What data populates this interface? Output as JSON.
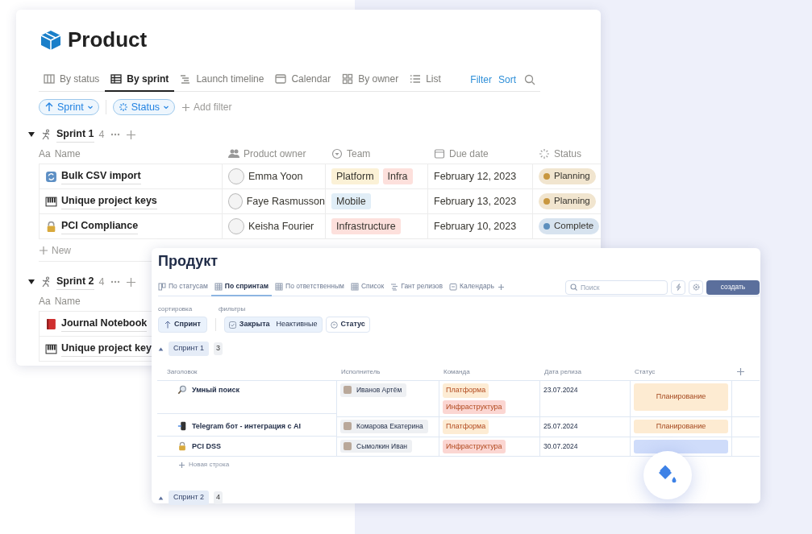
{
  "product_board": {
    "title": "Product",
    "tabs": [
      {
        "label": "By status",
        "selected": false
      },
      {
        "label": "By sprint",
        "selected": true
      },
      {
        "label": "Launch timeline",
        "selected": false
      },
      {
        "label": "Calendar",
        "selected": false
      },
      {
        "label": "By owner",
        "selected": false
      },
      {
        "label": "List",
        "selected": false
      }
    ],
    "actions": [
      "Filter",
      "Sort"
    ],
    "filters": [
      {
        "label": "Sprint"
      },
      {
        "label": "Status"
      }
    ],
    "add_filter": "Add filter",
    "groups": [
      {
        "name": "Sprint 1",
        "count": "4",
        "expanded": true,
        "title_column_marker": "Aa",
        "columns": [
          "Name",
          "Product owner",
          "Team",
          "Due date",
          "Status"
        ],
        "rows": [
          {
            "kind": "sync",
            "name": "Bulk CSV import",
            "owner": "Emma Yoon",
            "team": [
              {
                "label": "Platform",
                "color": "#fbf1d6"
              },
              {
                "label": "Infra",
                "color": "#fde0dc"
              }
            ],
            "due": "February 12, 2023",
            "status": {
              "label": "Planning",
              "color": "#c8973f"
            }
          },
          {
            "kind": "piano",
            "name": "Unique project keys",
            "owner": "Faye Rasmusson",
            "team": [
              {
                "label": "Mobile",
                "color": "#e1eef7"
              }
            ],
            "due": "February 13, 2023",
            "status": {
              "label": "Planning",
              "color": "#c8973f"
            }
          },
          {
            "kind": "lock",
            "name": "PCI Compliance",
            "owner": "Keisha Fourier",
            "team": [
              {
                "label": "Infrastructure",
                "color": "#fde0dc"
              }
            ],
            "due": "February 10, 2023",
            "status": {
              "label": "Complete",
              "color": "#5d8fbd"
            }
          }
        ],
        "new_row": "New"
      },
      {
        "name": "Sprint 2",
        "count": "4",
        "expanded": true,
        "title_column_marker": "Aa",
        "columns": [
          "Name"
        ],
        "rows": [
          {
            "kind": "book",
            "name": "Journal Notebook"
          },
          {
            "kind": "piano",
            "name": "Unique project key"
          }
        ]
      }
    ]
  },
  "produkt_board": {
    "title": "Продукт",
    "tabs": [
      {
        "label": "По статусам",
        "selected": false
      },
      {
        "label": "По спринтам",
        "selected": true
      },
      {
        "label": "По ответственным",
        "selected": false
      },
      {
        "label": "Список",
        "selected": false
      },
      {
        "label": "Гант релизов",
        "selected": false
      },
      {
        "label": "Календарь",
        "selected": false
      }
    ],
    "search": {
      "placeholder": "Поиск"
    },
    "create_button": "создать",
    "sort_label": "сортировка",
    "filters_label": "фильтры",
    "sort_chip": "Спринт",
    "filter_chips": [
      {
        "label": "Закрыта",
        "value": "Неактивные"
      },
      {
        "label": "Статус"
      }
    ],
    "groups": [
      {
        "name": "Спринт 1",
        "count": "3",
        "expanded": true,
        "columns": [
          "Заголовок",
          "Исполнитель",
          "Команда",
          "Дата релиза",
          "Статус"
        ],
        "rows": [
          {
            "kind": "search",
            "name": "Умный поиск",
            "assignee": "Иванов Артём",
            "team": [
              {
                "label": "Платформа",
                "color": "#fdecd4"
              },
              {
                "label": "Инфраструктура",
                "color": "#fbd6d2"
              }
            ],
            "release": "23.07.2024",
            "status": {
              "label": "Планирование",
              "color": "#fdebd2"
            }
          },
          {
            "kind": "phone",
            "name": "Telegram бот - интеграция с AI",
            "assignee": "Комарова Екатерина",
            "team": [
              {
                "label": "Платформа",
                "color": "#fdecd4"
              }
            ],
            "release": "25.07.2024",
            "status": {
              "label": "Планирование",
              "color": "#fdebd2"
            }
          },
          {
            "kind": "lock",
            "name": "PCI DSS",
            "assignee": "Сымолкин Иван",
            "team": [
              {
                "label": "Инфраструктура",
                "color": "#fbd6d2"
              }
            ],
            "release": "30.07.2024",
            "status": {
              "color": "#cfdcfa"
            }
          }
        ],
        "new_row": "Новая строка"
      },
      {
        "name": "Спринт 2",
        "count": "4",
        "expanded": true
      }
    ]
  }
}
